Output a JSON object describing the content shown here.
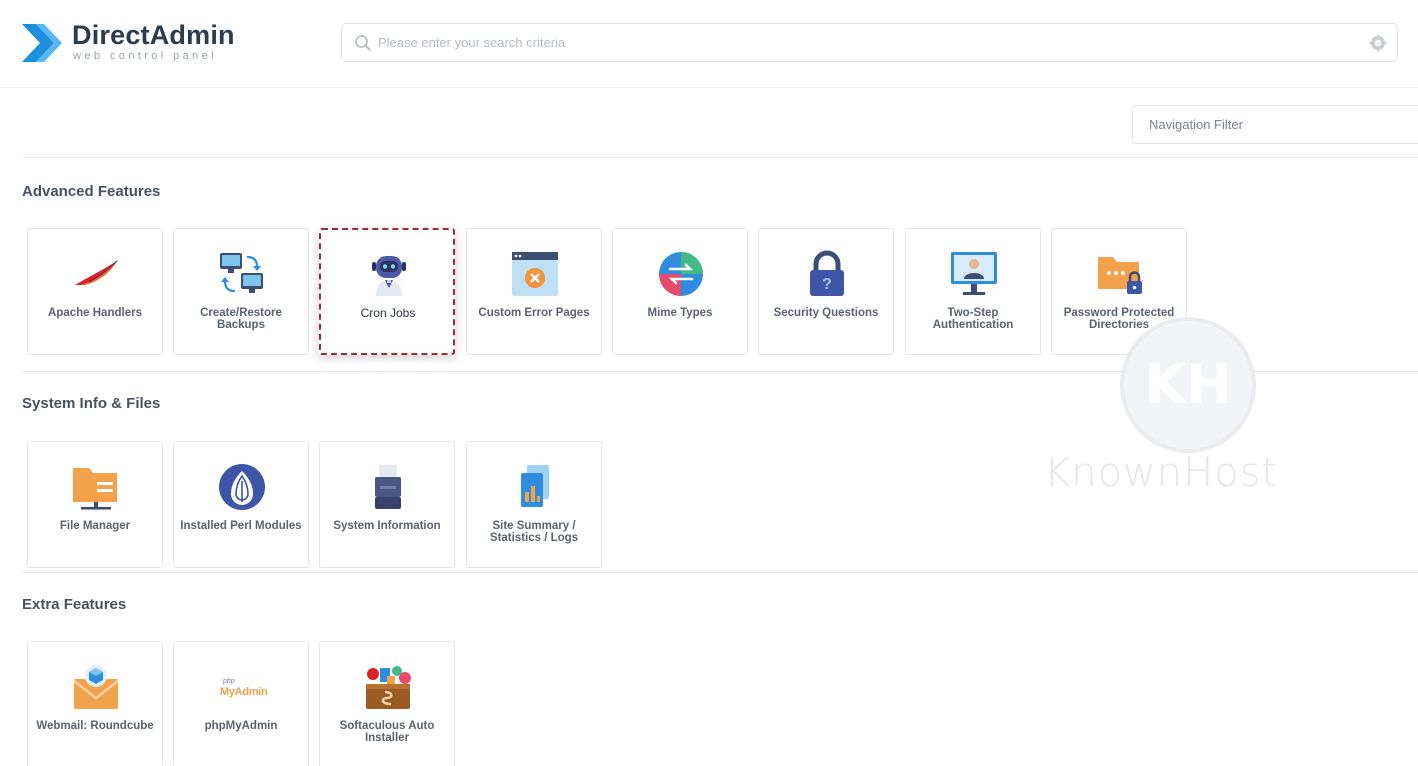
{
  "brand": {
    "name": "DirectAdmin",
    "tagline": "web control panel",
    "accent": "#1f8fe0"
  },
  "search": {
    "placeholder": "Please enter your search criteria"
  },
  "nav_filter": {
    "placeholder": "Navigation Filter"
  },
  "sections": [
    {
      "title": "Advanced Features",
      "items": [
        {
          "label": "Apache Handlers",
          "icon": "feather-icon"
        },
        {
          "label": "Create/Restore Backups",
          "icon": "backup-icon"
        },
        {
          "label": "Cron Jobs",
          "icon": "robot-icon",
          "highlighted": true
        },
        {
          "label": "Custom Error Pages",
          "icon": "error-page-icon"
        },
        {
          "label": "Mime Types",
          "icon": "mime-icon"
        },
        {
          "label": "Security Questions",
          "icon": "lock-icon"
        },
        {
          "label": "Two-Step Authentication",
          "icon": "monitor-user-icon"
        },
        {
          "label": "Password Protected Directories",
          "icon": "folder-lock-icon"
        }
      ]
    },
    {
      "title": "System Info & Files",
      "items": [
        {
          "label": "File Manager",
          "icon": "folder-icon"
        },
        {
          "label": "Installed Perl Modules",
          "icon": "onion-icon"
        },
        {
          "label": "System Information",
          "icon": "printer-icon"
        },
        {
          "label": "Site Summary / Statistics / Logs",
          "icon": "stats-icon"
        }
      ]
    },
    {
      "title": "Extra Features",
      "items": [
        {
          "label": "Webmail: Roundcube",
          "icon": "envelope-icon"
        },
        {
          "label": "phpMyAdmin",
          "icon": "phpmyadmin-icon"
        },
        {
          "label": "Softaculous Auto Installer",
          "icon": "softaculous-icon"
        }
      ]
    }
  ],
  "phpmyadmin_logo": {
    "small": "php",
    "large": "MyAdmin"
  },
  "watermark": {
    "text": "KnownHost",
    "mark": "KH"
  }
}
